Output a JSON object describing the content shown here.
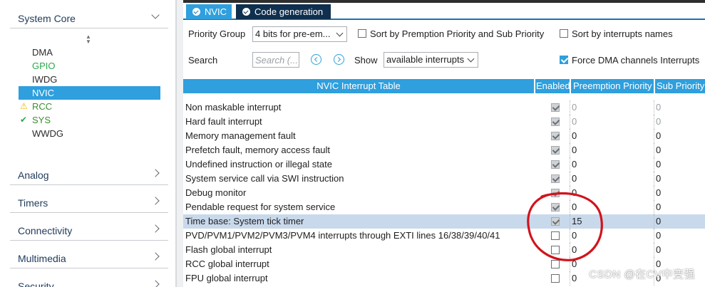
{
  "sidebar": {
    "system_core": {
      "label": "System Core"
    },
    "peripherals": [
      {
        "label": "DMA",
        "status": "none",
        "selected": false
      },
      {
        "label": "GPIO",
        "status": "configured",
        "selected": false
      },
      {
        "label": "IWDG",
        "status": "none",
        "selected": false
      },
      {
        "label": "NVIC",
        "status": "none",
        "selected": true
      },
      {
        "label": "RCC",
        "status": "warning",
        "selected": false
      },
      {
        "label": "SYS",
        "status": "ok",
        "selected": false
      },
      {
        "label": "WWDG",
        "status": "none",
        "selected": false
      }
    ],
    "categories": [
      {
        "label": "Analog"
      },
      {
        "label": "Timers"
      },
      {
        "label": "Connectivity"
      },
      {
        "label": "Multimedia"
      },
      {
        "label": "Security"
      }
    ]
  },
  "tabs": [
    {
      "label": "NVIC",
      "active": true
    },
    {
      "label": "Code generation",
      "active": false
    }
  ],
  "controls": {
    "priority_group_label": "Priority Group",
    "priority_group_value": "4 bits for pre-em...",
    "sort_premption_label": "Sort by Premption Priority and Sub Priority",
    "sort_premption_checked": false,
    "sort_names_label": "Sort by interrupts names",
    "sort_names_checked": false,
    "search_label": "Search",
    "search_placeholder": "Search (...",
    "show_label": "Show",
    "show_value": "available interrupts",
    "force_dma_label": "Force DMA channels Interrupts",
    "force_dma_checked": true
  },
  "table": {
    "columns": [
      "NVIC Interrupt Table",
      "Enabled",
      "Preemption Priority",
      "Sub Priority"
    ],
    "rows": [
      {
        "name": "Non maskable interrupt",
        "enabled": true,
        "locked": true,
        "preemption": "0",
        "sub": "0",
        "dim": true,
        "highlight": false
      },
      {
        "name": "Hard fault interrupt",
        "enabled": true,
        "locked": true,
        "preemption": "0",
        "sub": "0",
        "dim": true,
        "highlight": false
      },
      {
        "name": "Memory management fault",
        "enabled": true,
        "locked": true,
        "preemption": "0",
        "sub": "0",
        "dim": false,
        "highlight": false
      },
      {
        "name": "Prefetch fault, memory access fault",
        "enabled": true,
        "locked": true,
        "preemption": "0",
        "sub": "0",
        "dim": false,
        "highlight": false
      },
      {
        "name": "Undefined instruction or illegal state",
        "enabled": true,
        "locked": true,
        "preemption": "0",
        "sub": "0",
        "dim": false,
        "highlight": false
      },
      {
        "name": "System service call via SWI instruction",
        "enabled": true,
        "locked": true,
        "preemption": "0",
        "sub": "0",
        "dim": false,
        "highlight": false
      },
      {
        "name": "Debug monitor",
        "enabled": true,
        "locked": true,
        "preemption": "0",
        "sub": "0",
        "dim": false,
        "highlight": false
      },
      {
        "name": "Pendable request for system service",
        "enabled": true,
        "locked": true,
        "preemption": "0",
        "sub": "0",
        "dim": false,
        "highlight": false
      },
      {
        "name": "Time base: System tick timer",
        "enabled": true,
        "locked": true,
        "preemption": "15",
        "sub": "0",
        "dim": false,
        "highlight": true
      },
      {
        "name": "PVD/PVM1/PVM2/PVM3/PVM4 interrupts through EXTI lines 16/38/39/40/41",
        "enabled": false,
        "locked": false,
        "preemption": "0",
        "sub": "0",
        "dim": false,
        "highlight": false
      },
      {
        "name": "Flash global interrupt",
        "enabled": false,
        "locked": false,
        "preemption": "0",
        "sub": "0",
        "dim": false,
        "highlight": false
      },
      {
        "name": "RCC global interrupt",
        "enabled": false,
        "locked": false,
        "preemption": "0",
        "sub": "0",
        "dim": false,
        "highlight": false
      },
      {
        "name": "FPU global interrupt",
        "enabled": false,
        "locked": false,
        "preemption": "0",
        "sub": "0",
        "dim": false,
        "highlight": false
      }
    ]
  },
  "watermark": "CSDN @在CV中变强",
  "colors": {
    "accent": "#2f9fdd",
    "dark_tab": "#0f2f4f",
    "highlight_row": "#c9d9ec",
    "annotation": "#d0141c",
    "ok": "#2ea84a",
    "warning": "#f0b400"
  }
}
